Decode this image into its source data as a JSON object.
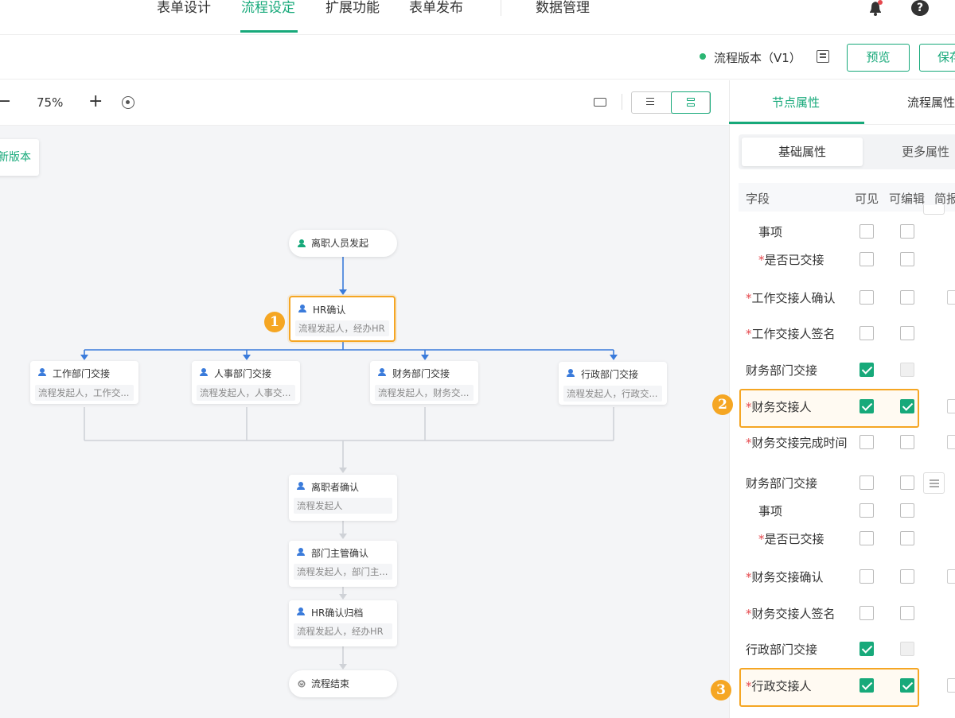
{
  "topnav": {
    "items": [
      {
        "label": "表单设计",
        "active": false
      },
      {
        "label": "流程设定",
        "active": true
      },
      {
        "label": "扩展功能",
        "active": false
      },
      {
        "label": "表单发布",
        "active": false
      },
      {
        "label": "数据管理",
        "active": false
      }
    ],
    "help": "?",
    "accent": "#17a97a"
  },
  "versionbar": {
    "version_label": "流程版本（V1）",
    "preview": "预览",
    "save": "保存"
  },
  "toolbar": {
    "zoom_minus": "−",
    "zoom": "75%",
    "zoom_plus": "+"
  },
  "new_version_label": "新版本",
  "flow": {
    "start": "离职人员发起",
    "hr_confirm": {
      "title": "HR确认",
      "sub": "流程发起人，经办HR"
    },
    "branches": [
      {
        "title": "工作部门交接",
        "sub": "流程发起人，工作交..."
      },
      {
        "title": "人事部门交接",
        "sub": "流程发起人，人事交..."
      },
      {
        "title": "财务部门交接",
        "sub": "流程发起人，财务交..."
      },
      {
        "title": "行政部门交接",
        "sub": "流程发起人，行政交..."
      }
    ],
    "leaver_confirm": {
      "title": "离职者确认",
      "sub": "流程发起人"
    },
    "manager_confirm": {
      "title": "部门主管确认",
      "sub": "流程发起人，部门主..."
    },
    "hr_archive": {
      "title": "HR确认归档",
      "sub": "流程发起人，经办HR"
    },
    "end": "流程结束"
  },
  "badges": [
    "1",
    "2",
    "3"
  ],
  "panel": {
    "tabs": [
      "节点属性",
      "流程属性"
    ],
    "segments": [
      "基础属性",
      "更多属性"
    ],
    "headers": {
      "field": "字段",
      "visible": "可见",
      "editable": "可编辑",
      "brief": "简报"
    },
    "rows": [
      {
        "label": "事项",
        "required": false,
        "visible": false,
        "editable": false
      },
      {
        "label": "是否已交接",
        "required": true,
        "visible": false,
        "editable": false
      },
      {
        "label": "工作交接人确认",
        "required": true,
        "visible": false,
        "editable": false
      },
      {
        "label": "工作交接人签名",
        "required": true,
        "visible": false,
        "editable": false
      },
      {
        "label": "财务部门交接",
        "required": false,
        "visible": true,
        "editable": "disabled"
      },
      {
        "label": "财务交接人",
        "required": true,
        "visible": true,
        "editable": true
      },
      {
        "label": "财务交接完成时间",
        "required": true,
        "visible": false,
        "editable": false
      },
      {
        "label": "财务部门交接",
        "required": false,
        "visible": false,
        "editable": false
      },
      {
        "label": "事项",
        "required": false,
        "visible": false,
        "editable": false
      },
      {
        "label": "是否已交接",
        "required": true,
        "visible": false,
        "editable": false
      },
      {
        "label": "财务交接确认",
        "required": true,
        "visible": false,
        "editable": false
      },
      {
        "label": "财务交接人签名",
        "required": true,
        "visible": false,
        "editable": false
      },
      {
        "label": "行政部门交接",
        "required": false,
        "visible": true,
        "editable": "disabled"
      },
      {
        "label": "行政交接人",
        "required": true,
        "visible": true,
        "editable": true
      }
    ],
    "required_mark": "*"
  }
}
